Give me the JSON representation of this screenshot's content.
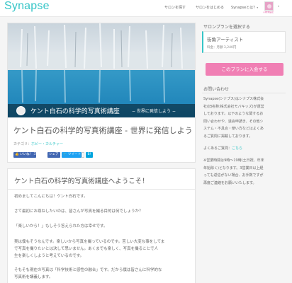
{
  "header": {
    "logo": "Synapse",
    "nav": [
      "サロンを探す",
      "サロンをはじめる",
      "Synapseとは？"
    ],
    "caret": "▾",
    "avatar_label": "人物未設定",
    "avatar_caret": "▾"
  },
  "course": {
    "hero_caption_title": "ケント白石の科学的写真術講座",
    "hero_caption_sub": "− 世界に発信しよう −",
    "title": "ケント白石の科学的写真術講座 - 世界に発信しよう",
    "category_label": "カテゴリ：",
    "category_value": "ホビー・カルチャー",
    "share": {
      "like": "👍 いいね！ 373",
      "like_count": "",
      "share": "シェア",
      "tweet": "🐦 ツイート",
      "bookmark": "B!"
    }
  },
  "body": {
    "title": "ケント白石の科学的写真術講座へようこそ！",
    "paragraphs": [
      "初めましてこんにちは！ケント白石です。",
      "さて最初にお尋ねしたいのは、皆さんが写真を撮る目的は何でしょうか？",
      "「楽しいから！」もしそう答えられた方は幸せです。",
      "実は僕もそうなんです。楽しいから写真を撮っているのです。苦しい大変な事をしてま",
      "で写真を撮りたいとは決して思いません。あくまでも楽しく、写真を撮ることで人",
      "生を楽しくしようと考えているのです。",
      "そもそも現在の写真は「科学技術と感性の融合」です。だから僕は皆さんに科学的な",
      "写真術を講義します。"
    ]
  },
  "sidebar": {
    "plan_label": "サロンプランを選択する",
    "plan_name": "街角アーティスト",
    "plan_price": "料金：月額 3,240円",
    "join_button": "このプランに入会する",
    "contact_label": "お問い合わせ",
    "contact_lines": [
      "Synapse(シナプス)はシナプス株式会",
      "社(旧名称:株式会社モバキッズ)が運営",
      "しております。以下のような関するお",
      "問い合わせや、退会申請き、その他シ",
      "ステム・不具合・使い方などはよくあ",
      "るご質問に掲載しております。"
    ],
    "faq_prefix": "よくあるご質問：",
    "faq_link": "こちら",
    "hours_lines": [
      "※営業時間は9時〜19時(土日祝、年末",
      "年始除く)となります。3営業日以上経",
      "っても返信がない場合、お手数ですが",
      "再度ご連絡をお願いいたします。"
    ]
  },
  "colors": {
    "accent": "#35c5c7",
    "pink": "#f07fb4",
    "facebook": "#4267b2",
    "twitter": "#1da1f2"
  }
}
